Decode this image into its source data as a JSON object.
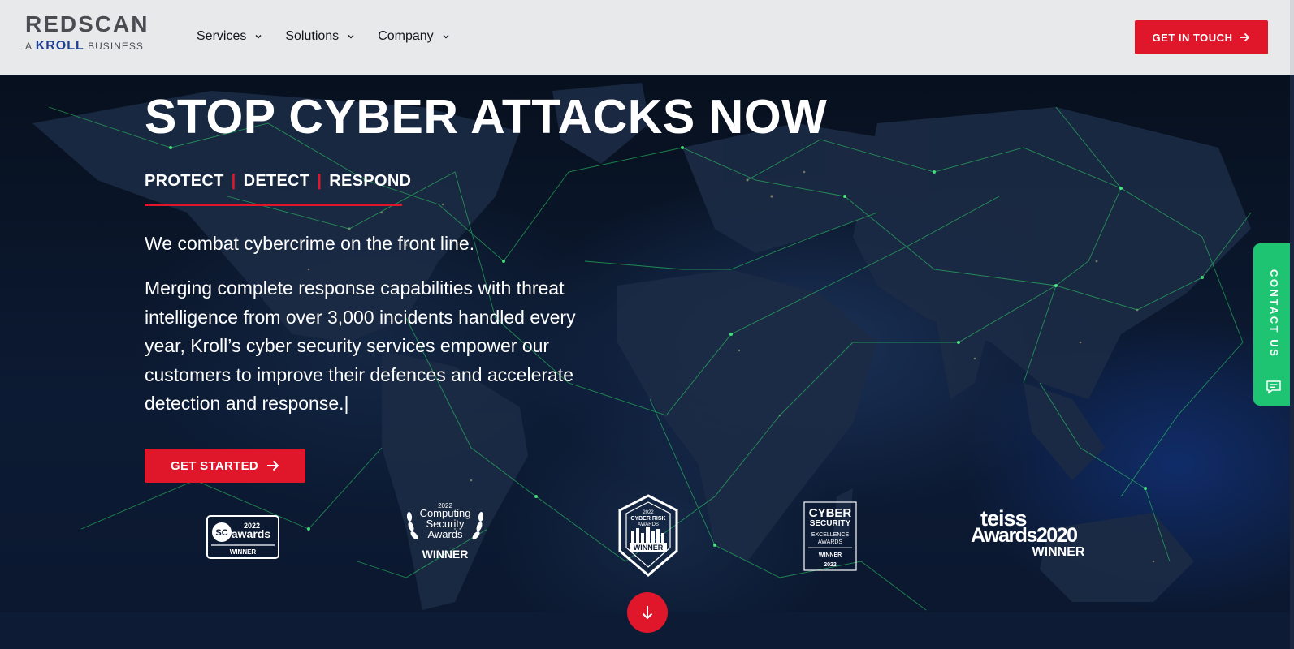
{
  "header": {
    "logo": {
      "wordmark": "REDSCAN",
      "prefix": "A",
      "brand": "KROLL",
      "suffix": "BUSINESS"
    },
    "nav": [
      {
        "label": "Services",
        "icon": "chevron-down-icon"
      },
      {
        "label": "Solutions",
        "icon": "chevron-down-icon"
      },
      {
        "label": "Company",
        "icon": "chevron-down-icon"
      }
    ],
    "cta_label": "GET IN TOUCH"
  },
  "hero": {
    "title": "STOP CYBER ATTACKS NOW",
    "tagline": [
      "PROTECT",
      "DETECT",
      "RESPOND"
    ],
    "tagline_separator": "|",
    "lead": "We combat cybercrime on the front line.",
    "body": "Merging complete response capabilities with threat intelligence from over 3,000 incidents handled every year, Kroll’s cyber security services empower our customers to improve their defences and accelerate detection and response.",
    "body_caret": "|",
    "cta_label": "GET STARTED"
  },
  "awards": [
    {
      "id": "sc",
      "line1": "2022",
      "line2": "awards",
      "badge": "SC",
      "status": "WINNER"
    },
    {
      "id": "computing",
      "year": "2022",
      "name_lines": [
        "Computing",
        "Security",
        "Awards"
      ],
      "status": "WINNER"
    },
    {
      "id": "cyber-risk",
      "year": "2022",
      "name_lines": [
        "CYBER RISK",
        "AWARDS"
      ],
      "status": "WINNER"
    },
    {
      "id": "cyber-security",
      "name_lines": [
        "CYBER",
        "SECURITY",
        "EXCELLENCE",
        "AWARDS"
      ],
      "status": "WINNER",
      "year": "2022"
    },
    {
      "id": "teiss",
      "brand": "teiss",
      "name": "Awards2020",
      "status": "WINNER"
    }
  ],
  "contact_tab": {
    "label": "CONTACT US",
    "icon": "chat-icon"
  },
  "scroll_button": {
    "icon": "arrow-down-icon"
  },
  "colors": {
    "accent_red": "#e0172b",
    "contact_green": "#1ec471",
    "header_bg": "#e8e9eb",
    "kroll_blue": "#1f3f8f"
  }
}
